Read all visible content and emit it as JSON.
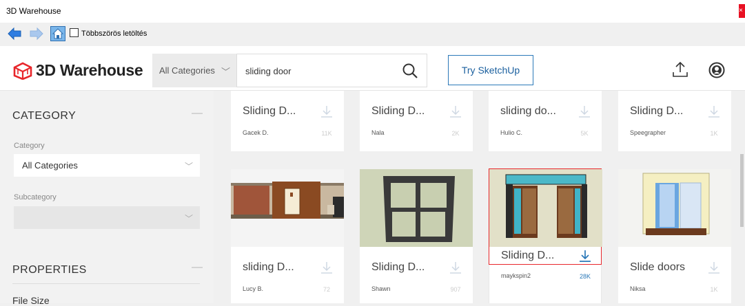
{
  "window": {
    "title": "3D Warehouse",
    "close_label": "×"
  },
  "navbar": {
    "back_icon": "arrow-left-icon",
    "forward_icon": "arrow-right-icon",
    "home_icon": "home-icon",
    "multi_download_label": "Többszörös letöltés",
    "multi_download_checked": false
  },
  "header": {
    "logo_text": "3D Warehouse",
    "category_select": "All Categories",
    "search_value": "sliding door",
    "try_label": "Try SketchUp",
    "upload_icon": "upload-icon",
    "user_icon": "user-icon",
    "accent_color": "#2a78b8",
    "brand_color": "#e8262b"
  },
  "sidebar": {
    "category_title": "CATEGORY",
    "collapse_label": "—",
    "category_label": "Category",
    "category_value": "All Categories",
    "subcategory_label": "Subcategory",
    "subcategory_value": "",
    "properties_title": "PROPERTIES",
    "properties_collapse": "—",
    "file_size_label": "File Size"
  },
  "results": {
    "row1": [
      {
        "title": "Sliding D...",
        "author": "Gacek D.",
        "count": "11K"
      },
      {
        "title": "Sliding D...",
        "author": "Nala",
        "count": "2K"
      },
      {
        "title": "sliding do...",
        "author": "Hulio C.",
        "count": "5K"
      },
      {
        "title": "Sliding D...",
        "author": "Speegrapher",
        "count": "1K"
      }
    ],
    "row2": [
      {
        "title": "sliding D...",
        "author": "Lucy B.",
        "count": "72",
        "selected": false
      },
      {
        "title": "Sliding D...",
        "author": "Shawn",
        "count": "907",
        "selected": false
      },
      {
        "title": "Sliding D...",
        "author": "maykspin2",
        "count": "28K",
        "selected": true
      },
      {
        "title": "Slide doors",
        "author": "Niksa",
        "count": "1K",
        "selected": false
      }
    ]
  }
}
